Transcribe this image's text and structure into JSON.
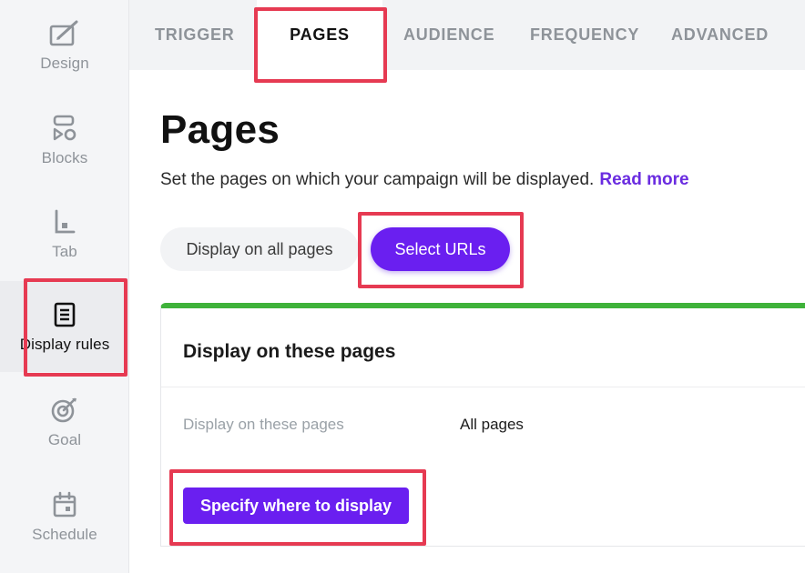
{
  "sidebar": {
    "items": [
      {
        "label": "Design",
        "icon": "design-icon"
      },
      {
        "label": "Blocks",
        "icon": "blocks-icon"
      },
      {
        "label": "Tab",
        "icon": "tab-icon"
      },
      {
        "label": "Display rules",
        "icon": "display-rules-icon",
        "active": true
      },
      {
        "label": "Goal",
        "icon": "goal-icon"
      },
      {
        "label": "Schedule",
        "icon": "schedule-icon"
      }
    ]
  },
  "tabs": [
    {
      "label": "TRIGGER"
    },
    {
      "label": "PAGES",
      "active": true
    },
    {
      "label": "AUDIENCE"
    },
    {
      "label": "FREQUENCY"
    },
    {
      "label": "ADVANCED"
    }
  ],
  "main": {
    "title": "Pages",
    "description": "Set the pages on which your campaign will be displayed.",
    "read_more": "Read more",
    "toggle": {
      "all_pages": "Display on all pages",
      "select_urls": "Select URLs",
      "selected": "Select URLs"
    },
    "card": {
      "title": "Display on these pages",
      "row_label": "Display on these pages",
      "row_value": "All pages",
      "button": "Specify where to display"
    }
  },
  "colors": {
    "accent": "#6a1ff0",
    "highlight": "#e63a52",
    "success_bar": "#3fb23a"
  }
}
